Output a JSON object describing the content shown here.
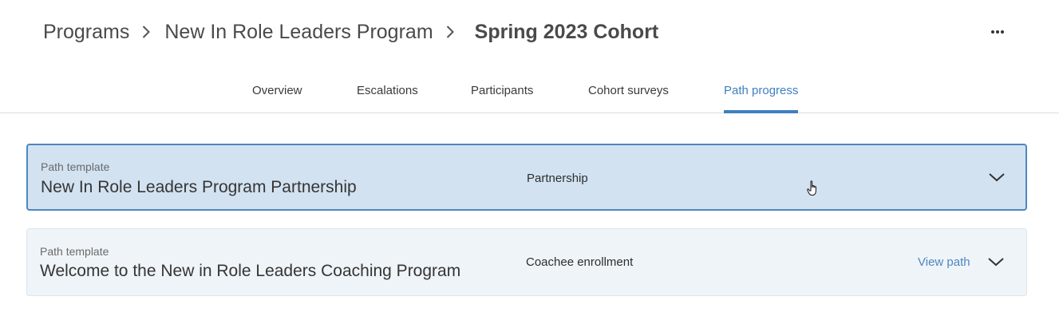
{
  "breadcrumb": {
    "items": [
      "Programs",
      "New In Role Leaders Program"
    ],
    "current": "Spring 2023 Cohort"
  },
  "header": {
    "more_icon": "more-horizontal-icon"
  },
  "tabs": [
    {
      "label": "Overview",
      "active": false
    },
    {
      "label": "Escalations",
      "active": false
    },
    {
      "label": "Participants",
      "active": false
    },
    {
      "label": "Cohort surveys",
      "active": false
    },
    {
      "label": "Path progress",
      "active": true
    }
  ],
  "paths": [
    {
      "caption": "Path template",
      "title": "New In Role Leaders Program Partnership",
      "type": "Partnership",
      "link": ""
    },
    {
      "caption": "Path template",
      "title": "Welcome to the New in Role Leaders Coaching Program",
      "type": "Coachee enrollment",
      "link": "View path"
    }
  ],
  "colors": {
    "accent": "#3f7fbf",
    "selected_card_bg": "#d2e2f1",
    "card_bg": "#eff4f8"
  }
}
